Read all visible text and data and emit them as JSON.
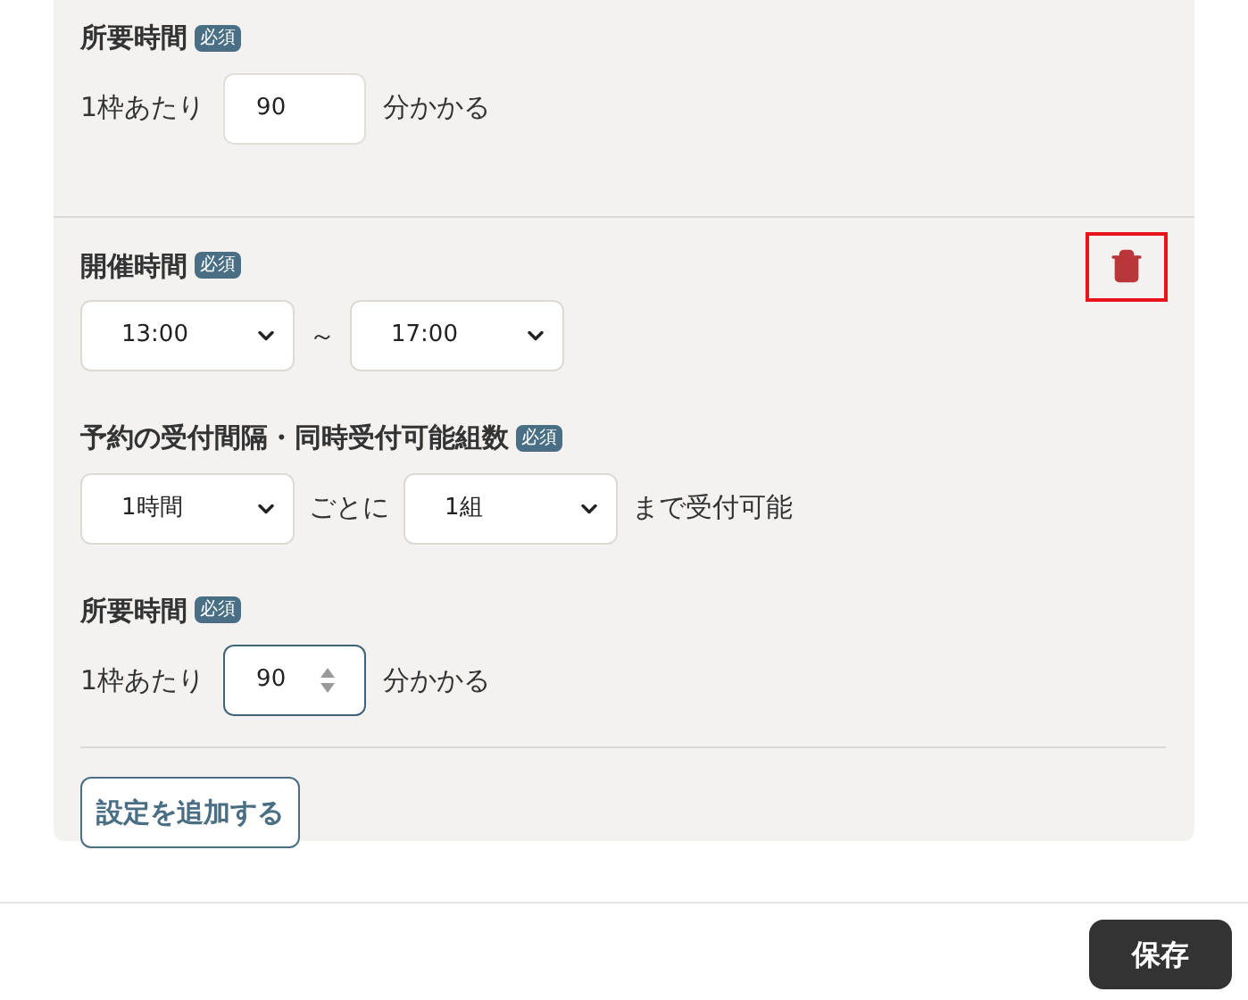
{
  "sections": [
    {
      "fields": [
        {
          "kind": "duration",
          "label": "所要時間",
          "badge": "必須",
          "prefix": "1枠あたり",
          "value": "90",
          "suffix": "分かかる",
          "focused": false
        }
      ]
    },
    {
      "delete_button": {
        "highlighted": true
      },
      "fields": [
        {
          "kind": "range",
          "label": "開催時間",
          "badge": "必須",
          "from": "13:00",
          "separator": "～",
          "to": "17:00"
        },
        {
          "kind": "interval",
          "label": "予約の受付間隔・同時受付可能組数",
          "badge": "必須",
          "interval": "1時間",
          "middle": "ごとに",
          "count": "1組",
          "suffix": "まで受付可能"
        },
        {
          "kind": "duration",
          "label": "所要時間",
          "badge": "必須",
          "prefix": "1枠あたり",
          "value": "90",
          "suffix": "分かかる",
          "focused": true
        }
      ]
    }
  ],
  "add_button": "設定を追加する",
  "save_button": "保存"
}
